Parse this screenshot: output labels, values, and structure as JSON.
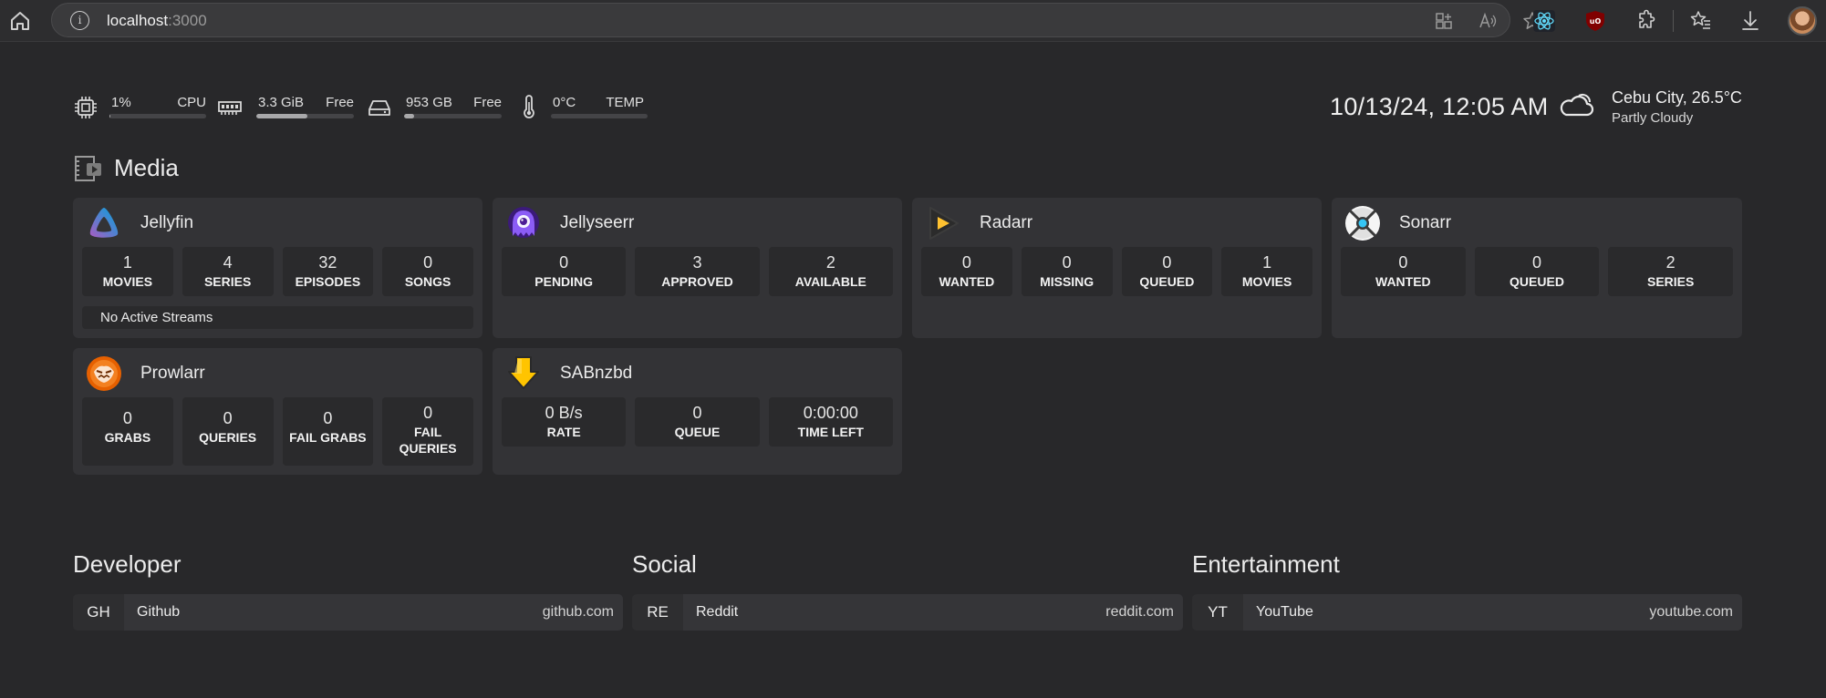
{
  "browser": {
    "url_host": "localhost",
    "url_port": ":3000"
  },
  "stats": {
    "cpu": {
      "value": "1%",
      "label": "CPU",
      "usage": 0.01
    },
    "memory": {
      "value": "3.3 GiB",
      "label": "Free",
      "usage": 0.52
    },
    "disk": {
      "value": "953 GB",
      "label": "Free",
      "usage": 0.1
    },
    "temp": {
      "value": "0°C",
      "label": "TEMP",
      "usage": 0.0
    }
  },
  "clock": "10/13/24, 12:05 AM",
  "weather": {
    "location": "Cebu City, 26.5°C",
    "condition": "Partly Cloudy",
    "icon": "partly-cloudy-icon"
  },
  "media": {
    "title": "Media",
    "services": [
      {
        "name": "Jellyfin",
        "icon": "jellyfin-icon",
        "stats": [
          {
            "value": "1",
            "label": "MOVIES"
          },
          {
            "value": "4",
            "label": "SERIES"
          },
          {
            "value": "32",
            "label": "EPISODES"
          },
          {
            "value": "0",
            "label": "SONGS"
          }
        ],
        "extra": "No Active Streams"
      },
      {
        "name": "Jellyseerr",
        "icon": "jellyseerr-icon",
        "stats": [
          {
            "value": "0",
            "label": "PENDING"
          },
          {
            "value": "3",
            "label": "APPROVED"
          },
          {
            "value": "2",
            "label": "AVAILABLE"
          }
        ]
      },
      {
        "name": "Radarr",
        "icon": "radarr-icon",
        "stats": [
          {
            "value": "0",
            "label": "WANTED"
          },
          {
            "value": "0",
            "label": "MISSING"
          },
          {
            "value": "0",
            "label": "QUEUED"
          },
          {
            "value": "1",
            "label": "MOVIES"
          }
        ]
      },
      {
        "name": "Sonarr",
        "icon": "sonarr-icon",
        "stats": [
          {
            "value": "0",
            "label": "WANTED"
          },
          {
            "value": "0",
            "label": "QUEUED"
          },
          {
            "value": "2",
            "label": "SERIES"
          }
        ]
      },
      {
        "name": "Prowlarr",
        "icon": "prowlarr-icon",
        "stats": [
          {
            "value": "0",
            "label": "GRABS"
          },
          {
            "value": "0",
            "label": "QUERIES"
          },
          {
            "value": "0",
            "label": "FAIL GRABS"
          },
          {
            "value": "0",
            "label": "FAIL QUERIES"
          }
        ]
      },
      {
        "name": "SABnzbd",
        "icon": "sabnzbd-icon",
        "stats": [
          {
            "value": "0 B/s",
            "label": "RATE"
          },
          {
            "value": "0",
            "label": "QUEUE"
          },
          {
            "value": "0:00:00",
            "label": "TIME LEFT"
          }
        ]
      }
    ]
  },
  "bookmarks": [
    {
      "group": "Developer",
      "abbr": "GH",
      "name": "Github",
      "url": "github.com"
    },
    {
      "group": "Social",
      "abbr": "RE",
      "name": "Reddit",
      "url": "reddit.com"
    },
    {
      "group": "Entertainment",
      "abbr": "YT",
      "name": "YouTube",
      "url": "youtube.com"
    }
  ]
}
